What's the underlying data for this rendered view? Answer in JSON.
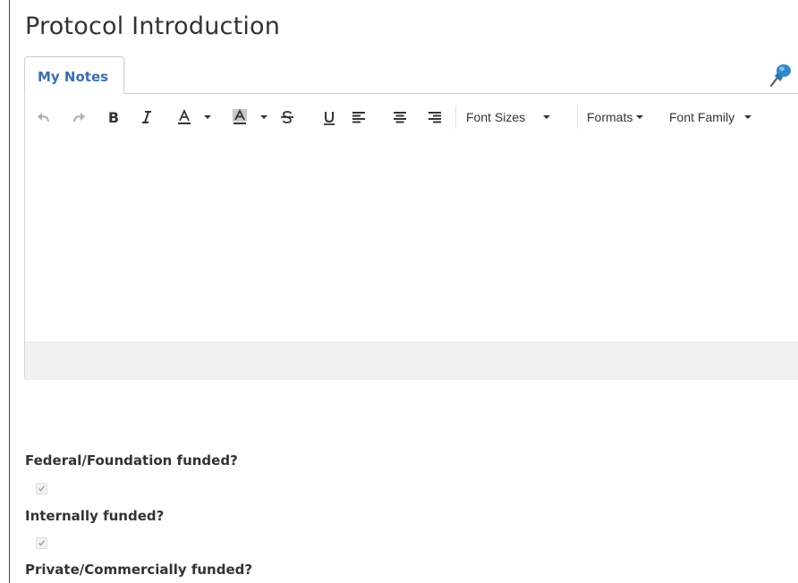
{
  "page_title": "Protocol Introduction",
  "notes_tab": {
    "label": "My Notes"
  },
  "toolbar": {
    "font_sizes_label": "Font Sizes",
    "formats_label": "Formats",
    "font_family_label": "Font Family"
  },
  "questions": [
    {
      "label": "Federal/Foundation funded?",
      "checked": true
    },
    {
      "label": "Internally funded?",
      "checked": true
    },
    {
      "label": "Private/Commercially funded?"
    }
  ],
  "colors": {
    "accent": "#3a6fb0",
    "text": "#333333",
    "disabled_icon": "#b0b0b0"
  },
  "icons": {
    "undo": "undo-icon",
    "redo": "redo-icon",
    "bold": "bold-icon",
    "italic": "italic-icon",
    "text_color": "text-color-icon",
    "background_color": "background-color-icon",
    "strikethrough": "strikethrough-icon",
    "underline": "underline-icon",
    "align_left": "align-left-icon",
    "align_center": "align-center-icon",
    "align_right": "align-right-icon",
    "pin": "pushpin-icon"
  }
}
